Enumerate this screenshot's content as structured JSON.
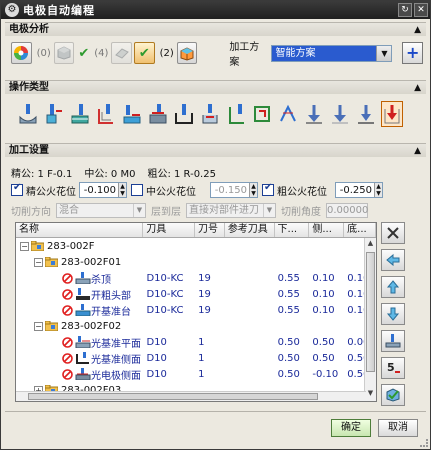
{
  "window": {
    "title": "电极自动编程"
  },
  "sections": {
    "geometry": "电极分析",
    "ops": "操作类型",
    "settings": "加工设置"
  },
  "geometry": {
    "count0": "(0)",
    "count4": "(4)",
    "count2": "(2)",
    "plan_label": "加工方案",
    "plan_value": "智能方案"
  },
  "tolerances": {
    "fine": "精公: 1 F-0.1",
    "mid": "中公: 0 M0",
    "rough": "粗公: 1 R-0.25"
  },
  "spark": {
    "fine_label": "精公火花位",
    "fine_value": "-0.100",
    "mid_label": "中公火花位",
    "mid_value": "-0.150",
    "rough_label": "粗公火花位",
    "rough_value": "-0.250"
  },
  "cut": {
    "direction_label": "切削方向",
    "direction_value": "混合",
    "layer_label": "层到层",
    "layer_value": "直接对部件进刀",
    "angle_label": "切削角度",
    "angle_value": "0.00000"
  },
  "table": {
    "headers": [
      "名称",
      "刀具",
      "刀号",
      "参考刀具",
      "下...",
      "侧...",
      "底..."
    ],
    "root": "283-002F",
    "groups": [
      {
        "name": "283-002F01",
        "rows": [
          {
            "name": "杀顶",
            "tool": "D10-KC",
            "num": "19",
            "ref": "",
            "down": "0.55",
            "side": "0.10",
            "bottom": "0.10"
          },
          {
            "name": "开粗头部",
            "tool": "D10-KC",
            "num": "19",
            "ref": "",
            "down": "0.55",
            "side": "0.10",
            "bottom": "0.10"
          },
          {
            "name": "开基准台",
            "tool": "D10-KC",
            "num": "19",
            "ref": "",
            "down": "0.55",
            "side": "0.10",
            "bottom": "0.10"
          }
        ]
      },
      {
        "name": "283-002F02",
        "rows": [
          {
            "name": "光基准平面",
            "tool": "D10",
            "num": "1",
            "ref": "",
            "down": "0.50",
            "side": "0.50",
            "bottom": "0.00"
          },
          {
            "name": "光基准侧面",
            "tool": "D10",
            "num": "1",
            "ref": "",
            "down": "0.50",
            "side": "0.50",
            "bottom": "0.50"
          },
          {
            "name": "光电极侧面",
            "tool": "D10",
            "num": "1",
            "ref": "",
            "down": "0.50",
            "side": "-0.10",
            "bottom": "0.50"
          }
        ]
      },
      {
        "name": "283-002F03",
        "rows": []
      }
    ]
  },
  "buttons": {
    "ok": "确定",
    "cancel": "取消"
  },
  "colors": {
    "accent": "#2a5bcf",
    "title_bar": "#2b2b2b",
    "row_text": "#1b2a9a"
  }
}
